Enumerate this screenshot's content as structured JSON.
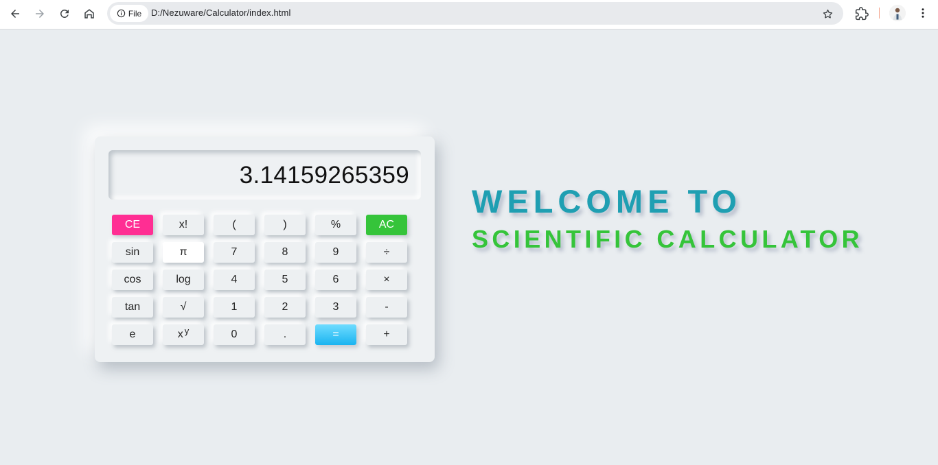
{
  "browser": {
    "file_chip_label": "File",
    "url": "D:/Nezuware/Calculator/index.html"
  },
  "calculator": {
    "display_value": "3.14159265359",
    "keys": {
      "ce": "CE",
      "factorial": "x!",
      "lparen": "(",
      "rparen": ")",
      "percent": "%",
      "ac": "AC",
      "sin": "sin",
      "pi": "π",
      "k7": "7",
      "k8": "8",
      "k9": "9",
      "divide": "÷",
      "cos": "cos",
      "log": "log",
      "k4": "4",
      "k5": "5",
      "k6": "6",
      "multiply": "×",
      "tan": "tan",
      "sqrt": "√",
      "k1": "1",
      "k2": "2",
      "k3": "3",
      "minus": "-",
      "e": "e",
      "power_base": "x",
      "power_exp": "y",
      "k0": "0",
      "dot": ".",
      "equals": "=",
      "plus": "+"
    },
    "colors": {
      "ce": "#ff2e93",
      "ac": "#35c43a",
      "equals": "#1ab4f0"
    }
  },
  "welcome": {
    "title": "WELCOME TO",
    "subtitle": "SCIENTIFIC CALCULATOR",
    "title_color": "#1f9fb2",
    "subtitle_color": "#35c43a"
  },
  "icons": [
    "back-arrow-icon",
    "forward-arrow-icon",
    "reload-icon",
    "home-icon",
    "info-icon",
    "star-icon",
    "extensions-icon",
    "avatar",
    "kebab-menu-icon"
  ]
}
